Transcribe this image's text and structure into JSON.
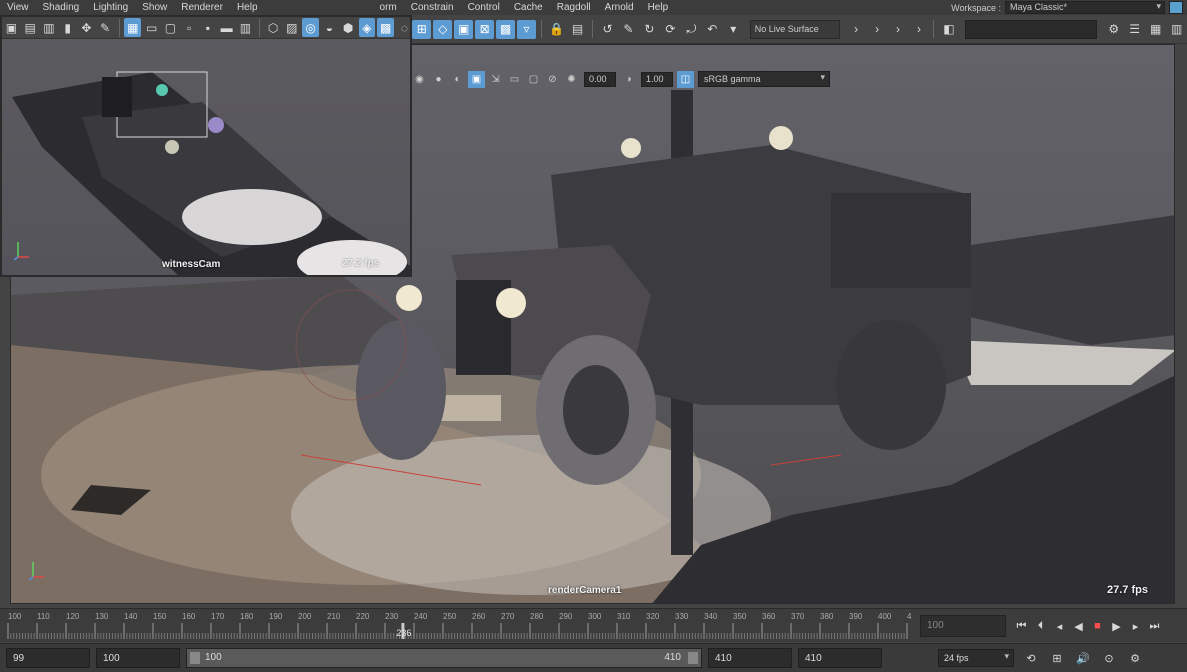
{
  "menu": {
    "items": [
      "View",
      "Shading",
      "Lighting",
      "Show",
      "Renderer",
      "Help"
    ],
    "items_right": [
      "orm",
      "Constrain",
      "Control",
      "Cache",
      "Ragdoll",
      "Arnold",
      "Help"
    ],
    "workspace_label": "Workspace :",
    "workspace_value": "Maya Classic*"
  },
  "toolbar": {
    "live_surface": "No Live Surface"
  },
  "viewport_toolbar": {
    "exposure": "0.00",
    "gamma": "1.00",
    "colorspace": "sRGB gamma"
  },
  "inset": {
    "camera_name": "witnessCam",
    "fps": "27.2 fps"
  },
  "main": {
    "camera_name": "renderCamera1",
    "fps": "27.7 fps"
  },
  "timeline": {
    "ticks": [
      "100",
      "110",
      "120",
      "130",
      "140",
      "150",
      "160",
      "170",
      "180",
      "190",
      "200",
      "210",
      "220",
      "230",
      "240",
      "250",
      "260",
      "270",
      "280",
      "290",
      "300",
      "310",
      "320",
      "330",
      "340",
      "350",
      "360",
      "370",
      "380",
      "390",
      "400",
      "4"
    ],
    "current_frame": "236",
    "current_frame_field": "100"
  },
  "range": {
    "start": "99",
    "playback_start": "100",
    "slider_start": "100",
    "slider_end": "410",
    "playback_end": "410",
    "end": "410",
    "fps": "24 fps"
  },
  "colors": {
    "accent": "#5d9bd3",
    "stop": "#ff4d4d"
  }
}
